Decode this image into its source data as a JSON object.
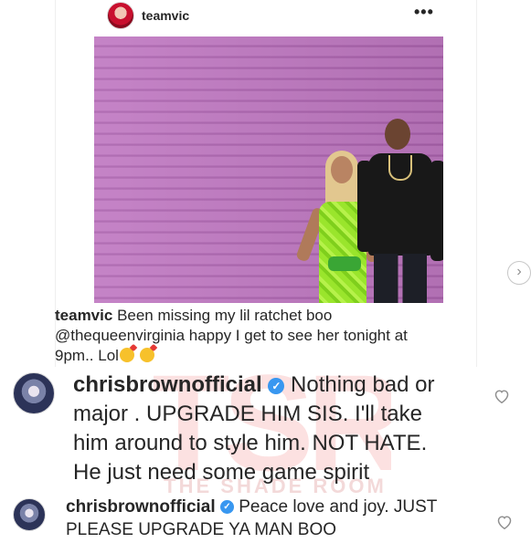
{
  "post": {
    "username": "teamvic",
    "more_glyph": "•••",
    "caption": {
      "username": "teamvic",
      "line1": "Been missing my lil ratchet boo",
      "mention": "@thequeenvirginia",
      "line2": "happy I get to see her tonight at",
      "line3": "9pm.. Lol"
    },
    "next_glyph": "›"
  },
  "comments": [
    {
      "username": "chrisbrownofficial",
      "text_line1": "Nothing bad or",
      "text_line2": "major .  UPGRADE  HIM SIS. I'll take",
      "text_line3": "him around to style him. NOT HATE.",
      "text_line4": "He just need some game spirit"
    },
    {
      "username": "chrisbrownofficial",
      "text_line1": "Peace love and joy. JUST",
      "text_line2": "PLEASE UPGRADE YA MAN BOO"
    }
  ],
  "watermark": {
    "logo": "TSR",
    "text": "THE SHADE ROOM"
  },
  "colors": {
    "verified": "#3897f0",
    "text": "#262626",
    "muted": "#8e8e8e"
  }
}
